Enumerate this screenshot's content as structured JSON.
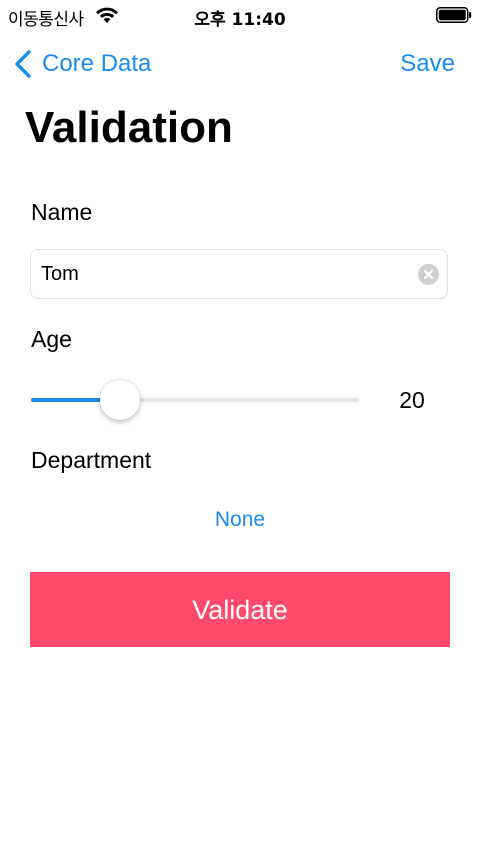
{
  "status_bar": {
    "carrier": "이동통신사",
    "time": "오후 11:40",
    "icons": [
      "wifi-icon",
      "battery-icon"
    ]
  },
  "nav": {
    "back_label": "Core Data",
    "back_icon": "chevron-left-icon",
    "save_label": "Save"
  },
  "title": "Validation",
  "form": {
    "name_label": "Name",
    "name_value": "Tom",
    "clear_icon": "clear-text-icon",
    "age_label": "Age",
    "age_value": "20",
    "age_slider_fraction": 0.24,
    "department_label": "Department",
    "department_value": "None"
  },
  "validate_label": "Validate",
  "colors": {
    "accent": "#1a8cf0",
    "validate_button": "#ff4a6b"
  }
}
